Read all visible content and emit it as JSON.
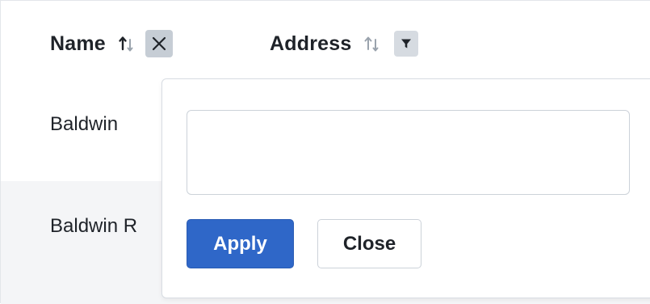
{
  "table": {
    "columns": [
      {
        "label": "Name",
        "sort_icon": "sort-arrows-icon",
        "filter_icon": "close-icon",
        "filter_active": true
      },
      {
        "label": "Address",
        "sort_icon": "sort-arrows-icon",
        "filter_icon": "filter-funnel-icon",
        "filter_active": false
      }
    ],
    "rows": [
      {
        "name": "Baldwin"
      },
      {
        "name": "Baldwin R"
      }
    ]
  },
  "filter_popover": {
    "input_value": "",
    "input_placeholder": "",
    "apply_label": "Apply",
    "close_label": "Close"
  },
  "colors": {
    "apply_button": "#2f67c8",
    "filter_active_bg": "#c6cdd5",
    "filter_inactive_bg": "#d6dbe1",
    "alt_row_bg": "#f4f5f7"
  }
}
